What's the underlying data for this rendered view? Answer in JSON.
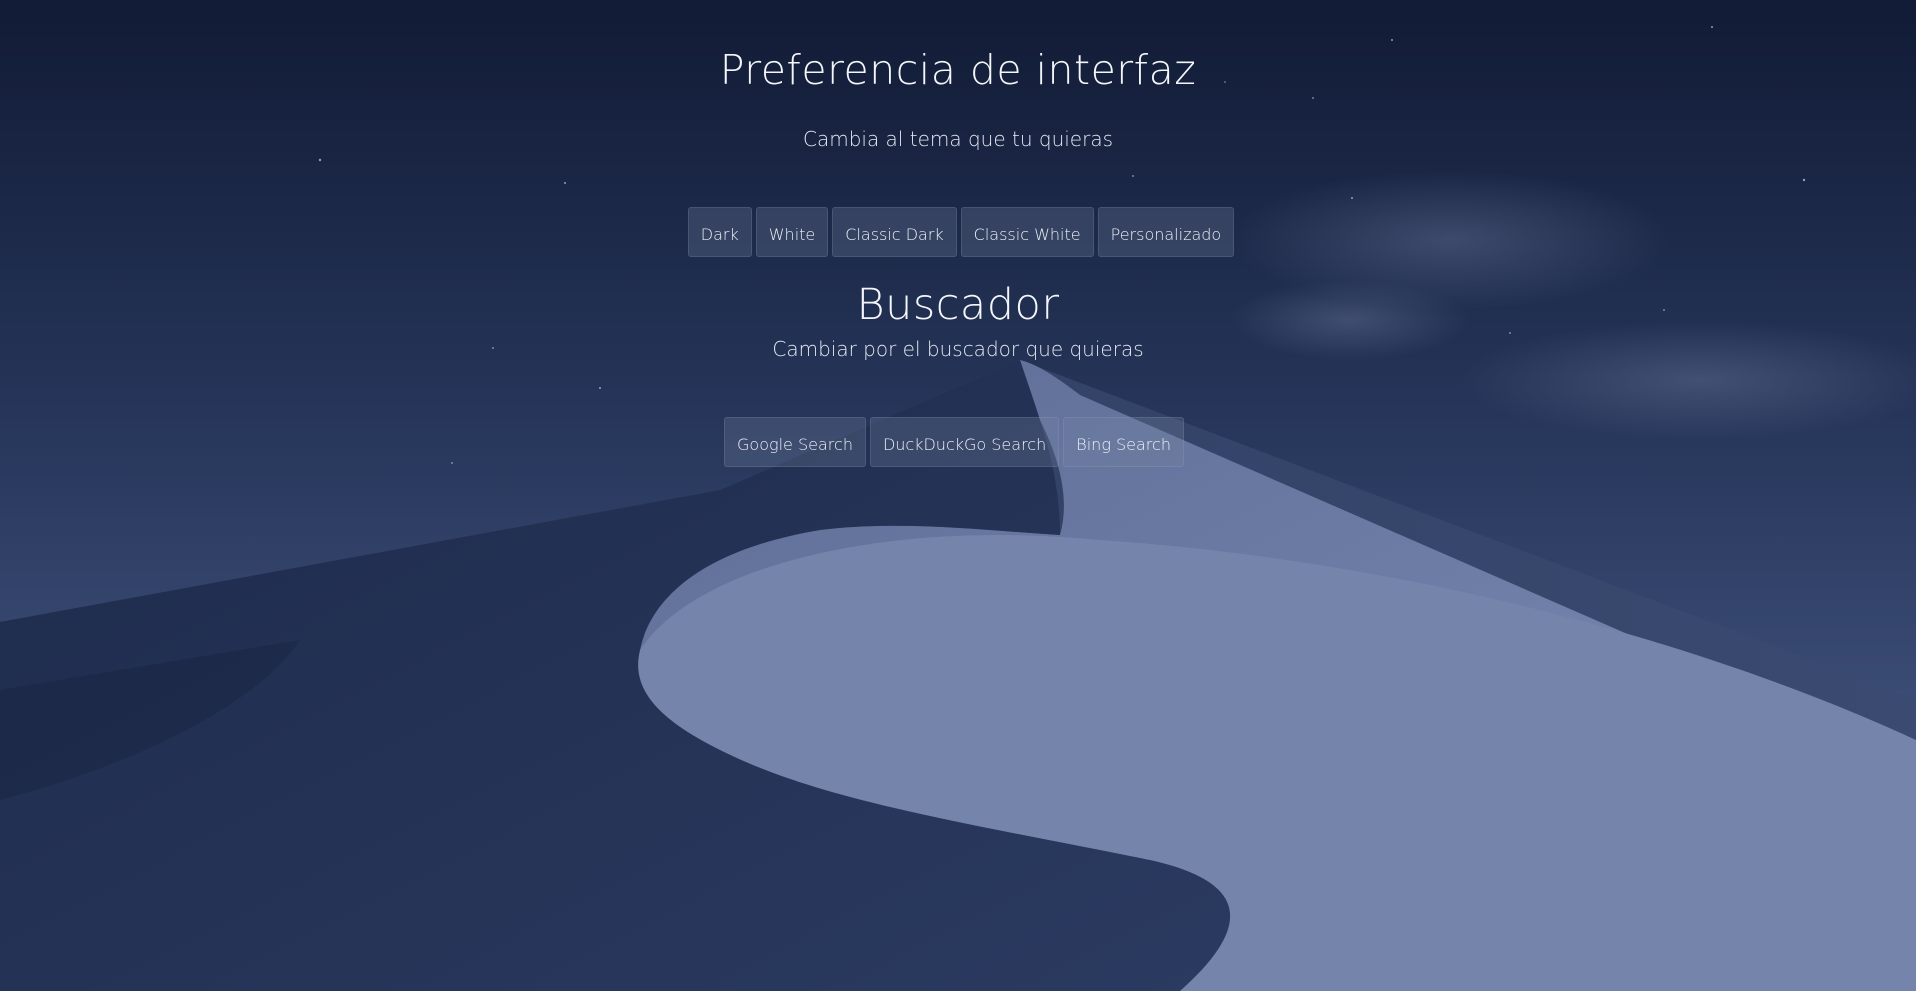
{
  "interface": {
    "title": "Preferencia de interfaz",
    "subtitle": "Cambia al tema que tu quieras",
    "themes": [
      {
        "label": "Dark"
      },
      {
        "label": "White"
      },
      {
        "label": "Classic Dark"
      },
      {
        "label": "Classic White"
      },
      {
        "label": "Personalizado"
      }
    ]
  },
  "search": {
    "title": "Buscador",
    "subtitle": "Cambiar por el buscador que quieras",
    "engines": [
      {
        "label": "Google Search"
      },
      {
        "label": "DuckDuckGo Search"
      },
      {
        "label": "Bing Search"
      }
    ]
  },
  "background": {
    "description_icon": "desert-dune-wallpaper",
    "sky_color": "#121d38",
    "dune_light_color": "#6a7aa3",
    "dune_shadow_color": "#1f2c4d"
  }
}
